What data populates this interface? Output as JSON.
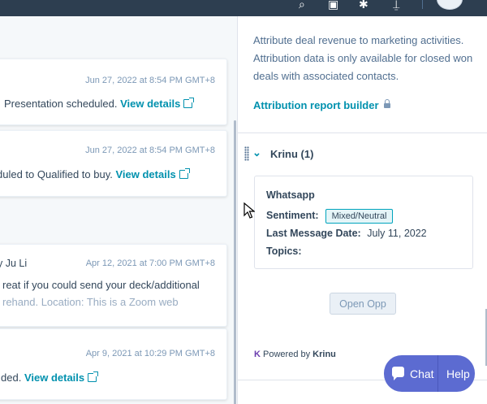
{
  "topbar": {
    "icons": [
      "search-icon",
      "calendar-icon",
      "settings-icon",
      "notifications-icon"
    ]
  },
  "timeline": {
    "cards": [
      {
        "date": "Jun 27, 2022 at 8:54 PM GMT+8",
        "text": "Presentation scheduled.",
        "link": "View details"
      },
      {
        "date": "Jun 27, 2022 at 8:54 PM GMT+8",
        "text": "duled to Qualified to buy.",
        "link": "View details"
      },
      {
        "date": "Apr 12, 2021 at 7:00 PM GMT+8",
        "who": "y Ju Li",
        "text": "reat if you could send your deck/additional",
        "text2": "rehand. Location: This is a Zoom web"
      },
      {
        "date": "Apr 9, 2021 at 10:29 PM GMT+8",
        "text": "ded.",
        "link": "View details"
      }
    ]
  },
  "attribution": {
    "description": "Attribute deal revenue to marketing activities. Attribution data is only available for closed won deals with associated contacts.",
    "link": "Attribution report builder"
  },
  "krinu": {
    "section_title": "Krinu (1)",
    "card_title": "Whatsapp",
    "sentiment_label": "Sentiment:",
    "sentiment_value": "Mixed/Neutral",
    "last_message_label": "Last Message Date:",
    "last_message_value": "July 11, 2022",
    "topics_label": "Topics:",
    "open_button": "Open Opp",
    "powered_prefix": "Powered by",
    "powered_brand": "Krinu",
    "logo_letter": "K"
  },
  "chat_widget": {
    "chat_label": "Chat",
    "help_label": "Help",
    "color": "#5c6bd1"
  }
}
